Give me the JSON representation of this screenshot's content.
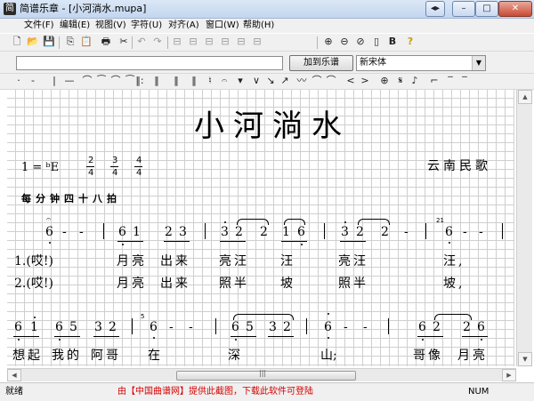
{
  "window": {
    "title": "简谱乐章 - [小河淌水.mupa]",
    "app_icon": "简",
    "controls": [
      "◂▸",
      "–",
      "□",
      "✕"
    ]
  },
  "menu": [
    "文件(F)",
    "编辑(E)",
    "视图(V)",
    "字符(U)",
    "对齐(A)",
    "窗口(W)",
    "帮助(H)"
  ],
  "toolbar1": [
    "new-icon",
    "open-icon",
    "save-icon",
    "copy-icon",
    "paste-icon",
    "print-icon",
    "cut-icon",
    "undo-icon",
    "redo-icon",
    "align-left-icon",
    "align-center-icon",
    "align-right-icon",
    "align-top-icon",
    "align-bottom-icon",
    "distribute-icon",
    "zoom-in-icon",
    "zoom-out-icon",
    "zoom-fit-icon",
    "page-icon",
    "bold-icon",
    "help-icon"
  ],
  "toolbar1_glyphs": [
    "🗋",
    "📂",
    "💾",
    "⎘",
    "📋",
    "🖶",
    "✂",
    "↶",
    "↷",
    "⊟",
    "⊟",
    "⊟",
    "⊟",
    "⊟",
    "⊟",
    "⊕",
    "⊖",
    "⊘",
    "▯",
    "B",
    "?"
  ],
  "input": {
    "value": "",
    "add_label": "加到乐谱",
    "font_value": "新宋体",
    "font_arrow": "▼"
  },
  "symbols": [
    "·",
    "-",
    "|",
    "—",
    "⌒",
    "⁀",
    "⌒",
    "⁀",
    "‖:",
    "‖",
    "‖",
    "‖",
    "♮",
    "𝄐",
    "▾",
    "∨",
    "↘",
    "↗",
    "〰",
    "⌒",
    "⌒",
    "<",
    ">",
    "⊕",
    "𝄋",
    "♪",
    "⌐",
    "‾",
    "‾"
  ],
  "score": {
    "title": "小河淌水",
    "key": "1 = ᵇE",
    "time_sigs": [
      [
        "2",
        "4"
      ],
      [
        "3",
        "4"
      ],
      [
        "4",
        "4"
      ]
    ],
    "origin": "云南民歌",
    "tempo": "每分钟四十八拍",
    "row1_notes": [
      "6",
      "-",
      "-",
      "6",
      "1",
      "2",
      "3",
      "3",
      "2",
      "2",
      "1",
      "6",
      "3",
      "2",
      "2",
      "-",
      "6",
      "-",
      "-"
    ],
    "grace1": "5",
    "grace2": "21",
    "grace3": "5",
    "lyric1": [
      "1.(哎!)",
      "月亮",
      "出来",
      "亮汪",
      "汪",
      "亮汪",
      "汪,"
    ],
    "lyric2": [
      "2.(哎!)",
      "月亮",
      "出来",
      "照半",
      "坡",
      "照半",
      "坡,"
    ],
    "row2_notes": [
      "6",
      "1",
      "6",
      "5",
      "3",
      "2",
      "6",
      "-",
      "-",
      "6",
      "5",
      "3",
      "2",
      "6",
      "-",
      "-",
      "6",
      "2",
      "2",
      "6"
    ],
    "lyric3": [
      "想起",
      "我的",
      "阿哥",
      "在",
      "深",
      "山;",
      "哥像",
      "月亮"
    ]
  },
  "status": {
    "left": "就绪",
    "center": "由【中国曲谱网】提供此截图，下载此软件可登陆",
    "right": "NUM"
  },
  "scroll": {
    "up": "▲",
    "down": "▼",
    "left": "◀",
    "right": "▶",
    "grip": "|||"
  }
}
